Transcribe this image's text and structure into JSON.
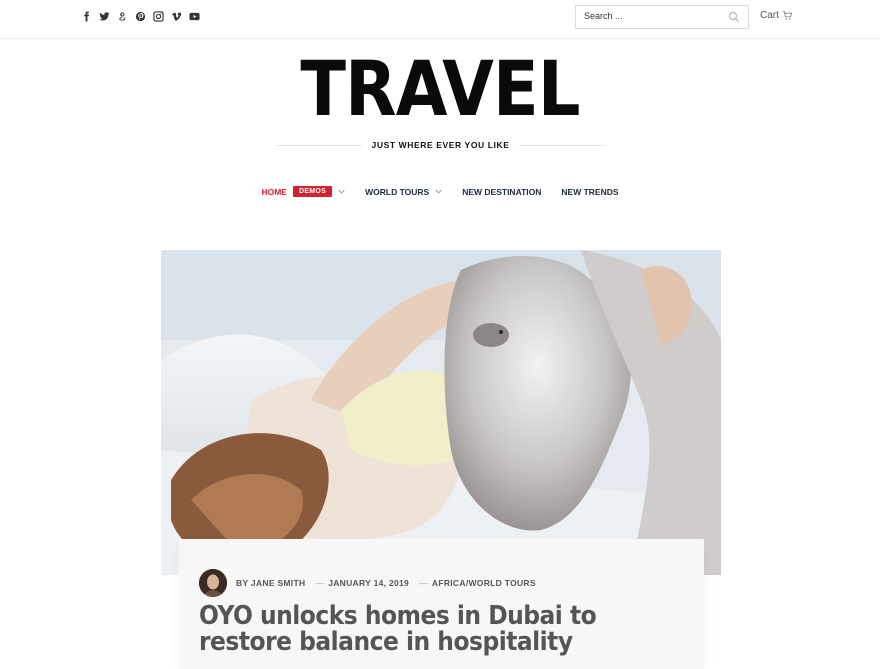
{
  "social": {
    "icons": [
      "facebook-icon",
      "twitter-icon",
      "google-plus-icon",
      "pinterest-icon",
      "instagram-icon",
      "vimeo-icon",
      "youtube-icon"
    ]
  },
  "search": {
    "placeholder": "Search ..."
  },
  "cart": {
    "label": "Cart"
  },
  "brand": {
    "logo": "TRAVEL",
    "tagline": "JUST WHERE EVER YOU LIKE"
  },
  "nav": {
    "home": "HOME",
    "demos_badge": "DEMOS",
    "world_tours": "WORLD TOURS",
    "new_destination": "NEW DESTINATION",
    "new_trends": "NEW TRENDS"
  },
  "post": {
    "author": "BY JANE SMITH",
    "date": "JANUARY 14, 2019",
    "category": "AFRICA/WORLD TOURS",
    "title": "OYO unlocks homes in Dubai to restore balance in hospitality"
  },
  "colors": {
    "accent": "#d0232f",
    "nav_text": "#1f2b3a"
  }
}
